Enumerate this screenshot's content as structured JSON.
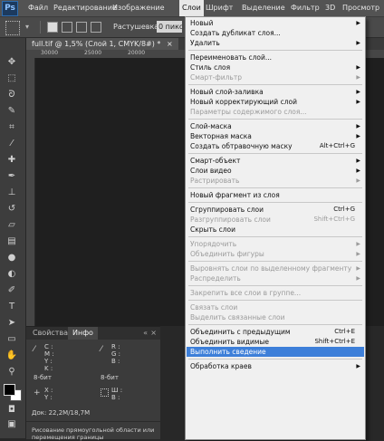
{
  "app": {
    "logo": "Ps"
  },
  "menubar": {
    "items": [
      {
        "label": "Файл"
      },
      {
        "label": "Редактирование"
      },
      {
        "label": "Изображение"
      },
      {
        "label": "Слои",
        "active": true
      },
      {
        "label": "Шрифт"
      },
      {
        "label": "Выделение"
      },
      {
        "label": "Фильтр"
      },
      {
        "label": "3D"
      },
      {
        "label": "Просмотр"
      }
    ]
  },
  "options": {
    "feather_label": "Растушевка:",
    "feather_value": "0 пикс."
  },
  "document": {
    "tab_title": "full.tif @ 1,5% (Слой 1, CMYK/8#) *",
    "close_glyph": "×"
  },
  "ruler": {
    "marks": [
      "30000",
      "25000",
      "20000"
    ]
  },
  "panels": {
    "tabs": [
      "Свойства",
      "Инфо"
    ],
    "info": {
      "cmyk_labels": [
        "C :",
        "M :",
        "Y :",
        "K :"
      ],
      "rgb_labels": [
        "R :",
        "G :",
        "B :"
      ],
      "bitdepth_left": "8-бит",
      "bitdepth_right": "8-бит",
      "xy": [
        "X :",
        "Y :"
      ],
      "wh": [
        "Ш :",
        "В :"
      ]
    },
    "doc_info": "Док: 22,2M/18,7M",
    "status": "Рисование прямоугольной области или перемещения границы"
  },
  "dropdown": {
    "items": [
      {
        "label": "Новый",
        "arrow": true
      },
      {
        "label": "Создать дубликат слоя...",
        "arrow": false
      },
      {
        "label": "Удалить",
        "arrow": true
      },
      {
        "sep": true
      },
      {
        "label": "Переименовать слой...",
        "arrow": false
      },
      {
        "label": "Стиль слоя",
        "arrow": true
      },
      {
        "label": "Смарт-фильтр",
        "arrow": true,
        "disabled": true
      },
      {
        "sep": true
      },
      {
        "label": "Новый слой-заливка",
        "arrow": true
      },
      {
        "label": "Новый корректирующий слой",
        "arrow": true
      },
      {
        "label": "Параметры содержимого слоя...",
        "disabled": true
      },
      {
        "sep": true
      },
      {
        "label": "Слой-маска",
        "arrow": true
      },
      {
        "label": "Векторная маска",
        "arrow": true
      },
      {
        "label": "Создать обтравочную маску",
        "shortcut": "Alt+Ctrl+G"
      },
      {
        "sep": true
      },
      {
        "label": "Смарт-объект",
        "arrow": true
      },
      {
        "label": "Слои видео",
        "arrow": true
      },
      {
        "label": "Растрировать",
        "arrow": true,
        "disabled": true
      },
      {
        "sep": true
      },
      {
        "label": "Новый фрагмент из слоя"
      },
      {
        "sep": true
      },
      {
        "label": "Сгруппировать слои",
        "shortcut": "Ctrl+G"
      },
      {
        "label": "Разгруппировать слои",
        "shortcut": "Shift+Ctrl+G",
        "disabled": true
      },
      {
        "label": "Скрыть слои"
      },
      {
        "sep": true
      },
      {
        "label": "Упорядочить",
        "arrow": true,
        "disabled": true
      },
      {
        "label": "Объединить фигуры",
        "arrow": true,
        "disabled": true
      },
      {
        "sep": true
      },
      {
        "label": "Выровнять слои по выделенному фрагменту",
        "arrow": true,
        "disabled": true
      },
      {
        "label": "Распределить",
        "arrow": true,
        "disabled": true
      },
      {
        "sep": true
      },
      {
        "label": "Закрепить все слои в группе...",
        "disabled": true
      },
      {
        "sep": true
      },
      {
        "label": "Связать слои",
        "disabled": true
      },
      {
        "label": "Выделить связанные слои",
        "disabled": true
      },
      {
        "sep": true
      },
      {
        "label": "Объединить с предыдущим",
        "shortcut": "Ctrl+E"
      },
      {
        "label": "Объединить видимые",
        "shortcut": "Shift+Ctrl+E"
      },
      {
        "label": "Выполнить сведение",
        "highlight": true
      },
      {
        "sep": true
      },
      {
        "label": "Обработка краев",
        "arrow": true
      }
    ]
  }
}
